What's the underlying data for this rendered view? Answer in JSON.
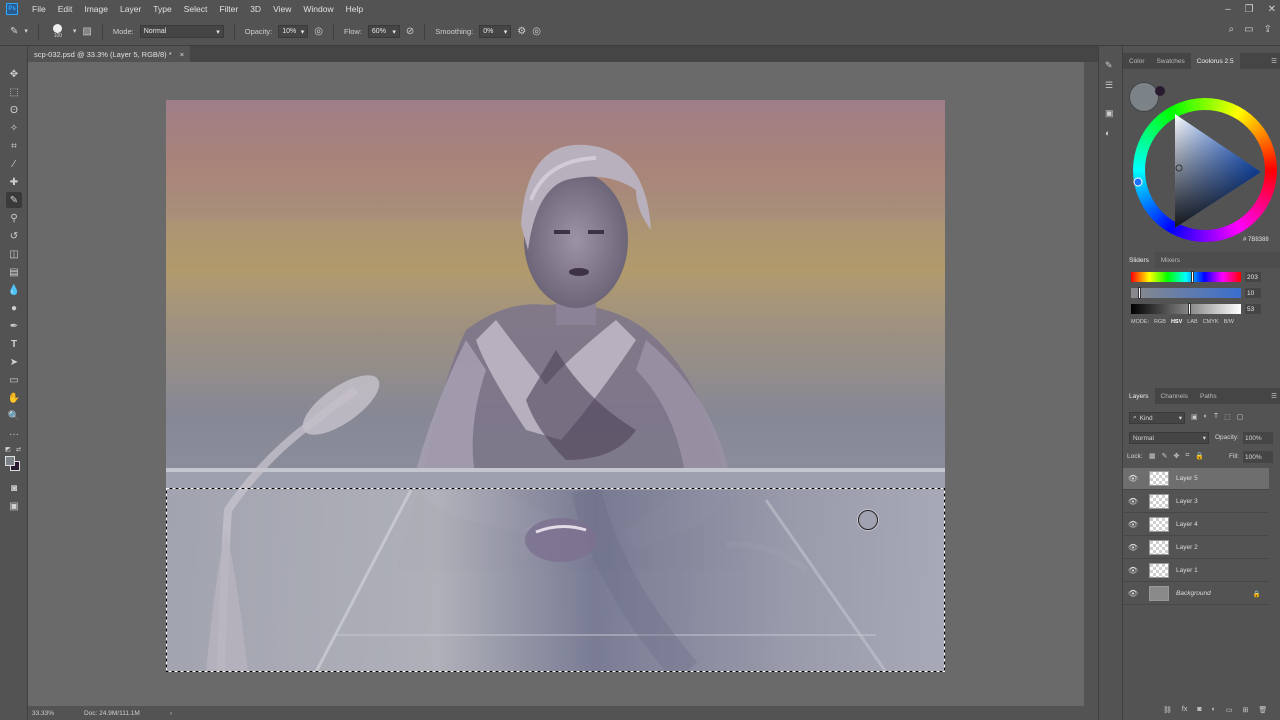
{
  "menu": [
    "File",
    "Edit",
    "Image",
    "Layer",
    "Type",
    "Select",
    "Filter",
    "3D",
    "View",
    "Window",
    "Help"
  ],
  "options": {
    "mode_label": "Mode:",
    "mode_value": "Normal",
    "opacity_label": "Opacity:",
    "opacity_value": "10%",
    "flow_label": "Flow:",
    "flow_value": "60%",
    "smoothing_label": "Smoothing:",
    "smoothing_value": "0%",
    "brush_size": "100"
  },
  "document_tab": {
    "title": "scp-032.psd @ 33.3% (Layer 5, RGB/8) *",
    "close": "×"
  },
  "status": {
    "zoom": "33.33%",
    "doc": "Doc: 24.9M/111.1M",
    "arrow": "›"
  },
  "color_panel": {
    "tabs": [
      "Color",
      "Swatches",
      "Coolorus 2.5"
    ],
    "hex": "# 7B8388",
    "sub_tabs": [
      "Sliders",
      "Mixers"
    ],
    "values": [
      "203",
      "10",
      "53"
    ],
    "modes_label": "MODE:",
    "modes": [
      "RGB",
      "HSV",
      "LAB",
      "CMYK",
      "B/W"
    ]
  },
  "layers_panel": {
    "tabs": [
      "Layers",
      "Channels",
      "Paths"
    ],
    "kind": "Kind",
    "blend": "Normal",
    "opacity_label": "Opacity:",
    "opacity_value": "100%",
    "lock_label": "Lock:",
    "fill_label": "Fill:",
    "fill_value": "100%",
    "layers": [
      {
        "name": "Layer 5",
        "selected": true
      },
      {
        "name": "Layer 3",
        "selected": false
      },
      {
        "name": "Layer 4",
        "selected": false
      },
      {
        "name": "Layer 2",
        "selected": false
      },
      {
        "name": "Layer 1",
        "selected": false
      },
      {
        "name": "Background",
        "selected": false
      }
    ]
  },
  "colors": {
    "accent": "#31a8ff",
    "ui_bg": "#535353",
    "panel_dark": "#454545",
    "selected_layer": "#6e6e6e"
  }
}
